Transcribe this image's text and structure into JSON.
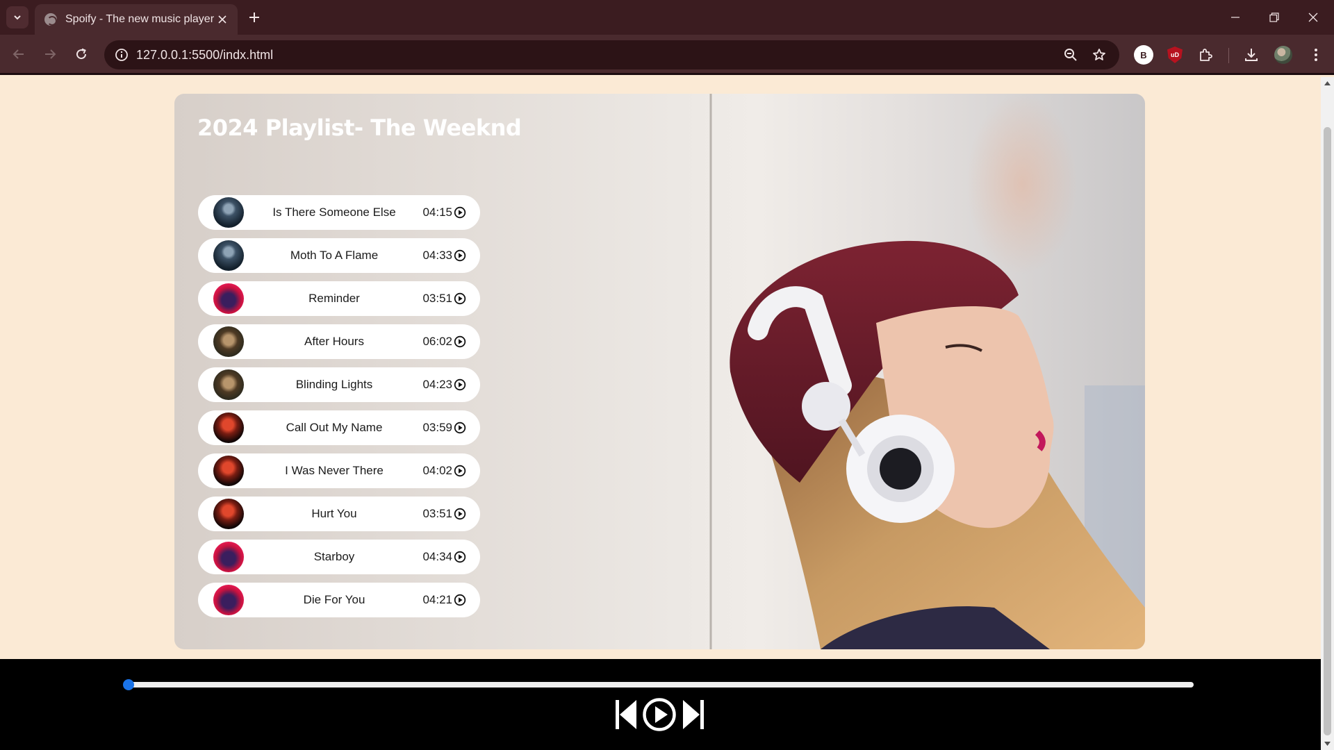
{
  "browser": {
    "tab_title": "Spoify - The new music player",
    "url": "127.0.0.1:5500/indx.html",
    "profile_initial": "B",
    "ublock_label": "uD"
  },
  "page": {
    "title": "2024 Playlist- The Weeknd",
    "accent_color": "#1a73e8",
    "songs": [
      {
        "name": "Is There Someone Else",
        "duration": "04:15",
        "cover": "blue-portrait"
      },
      {
        "name": "Moth To A Flame",
        "duration": "04:33",
        "cover": "blue-portrait"
      },
      {
        "name": "Reminder",
        "duration": "03:51",
        "cover": "starboy-red"
      },
      {
        "name": "After Hours",
        "duration": "06:02",
        "cover": "after-hours"
      },
      {
        "name": "Blinding Lights",
        "duration": "04:23",
        "cover": "after-hours"
      },
      {
        "name": "Call Out My Name",
        "duration": "03:59",
        "cover": "red-dark"
      },
      {
        "name": "I Was Never There",
        "duration": "04:02",
        "cover": "red-dark"
      },
      {
        "name": "Hurt You",
        "duration": "03:51",
        "cover": "red-dark"
      },
      {
        "name": "Starboy",
        "duration": "04:34",
        "cover": "starboy-red"
      },
      {
        "name": "Die For You",
        "duration": "04:21",
        "cover": "starboy-red"
      }
    ]
  },
  "player": {
    "progress": 0,
    "controls": [
      "previous-icon",
      "play-icon",
      "next-icon"
    ]
  }
}
